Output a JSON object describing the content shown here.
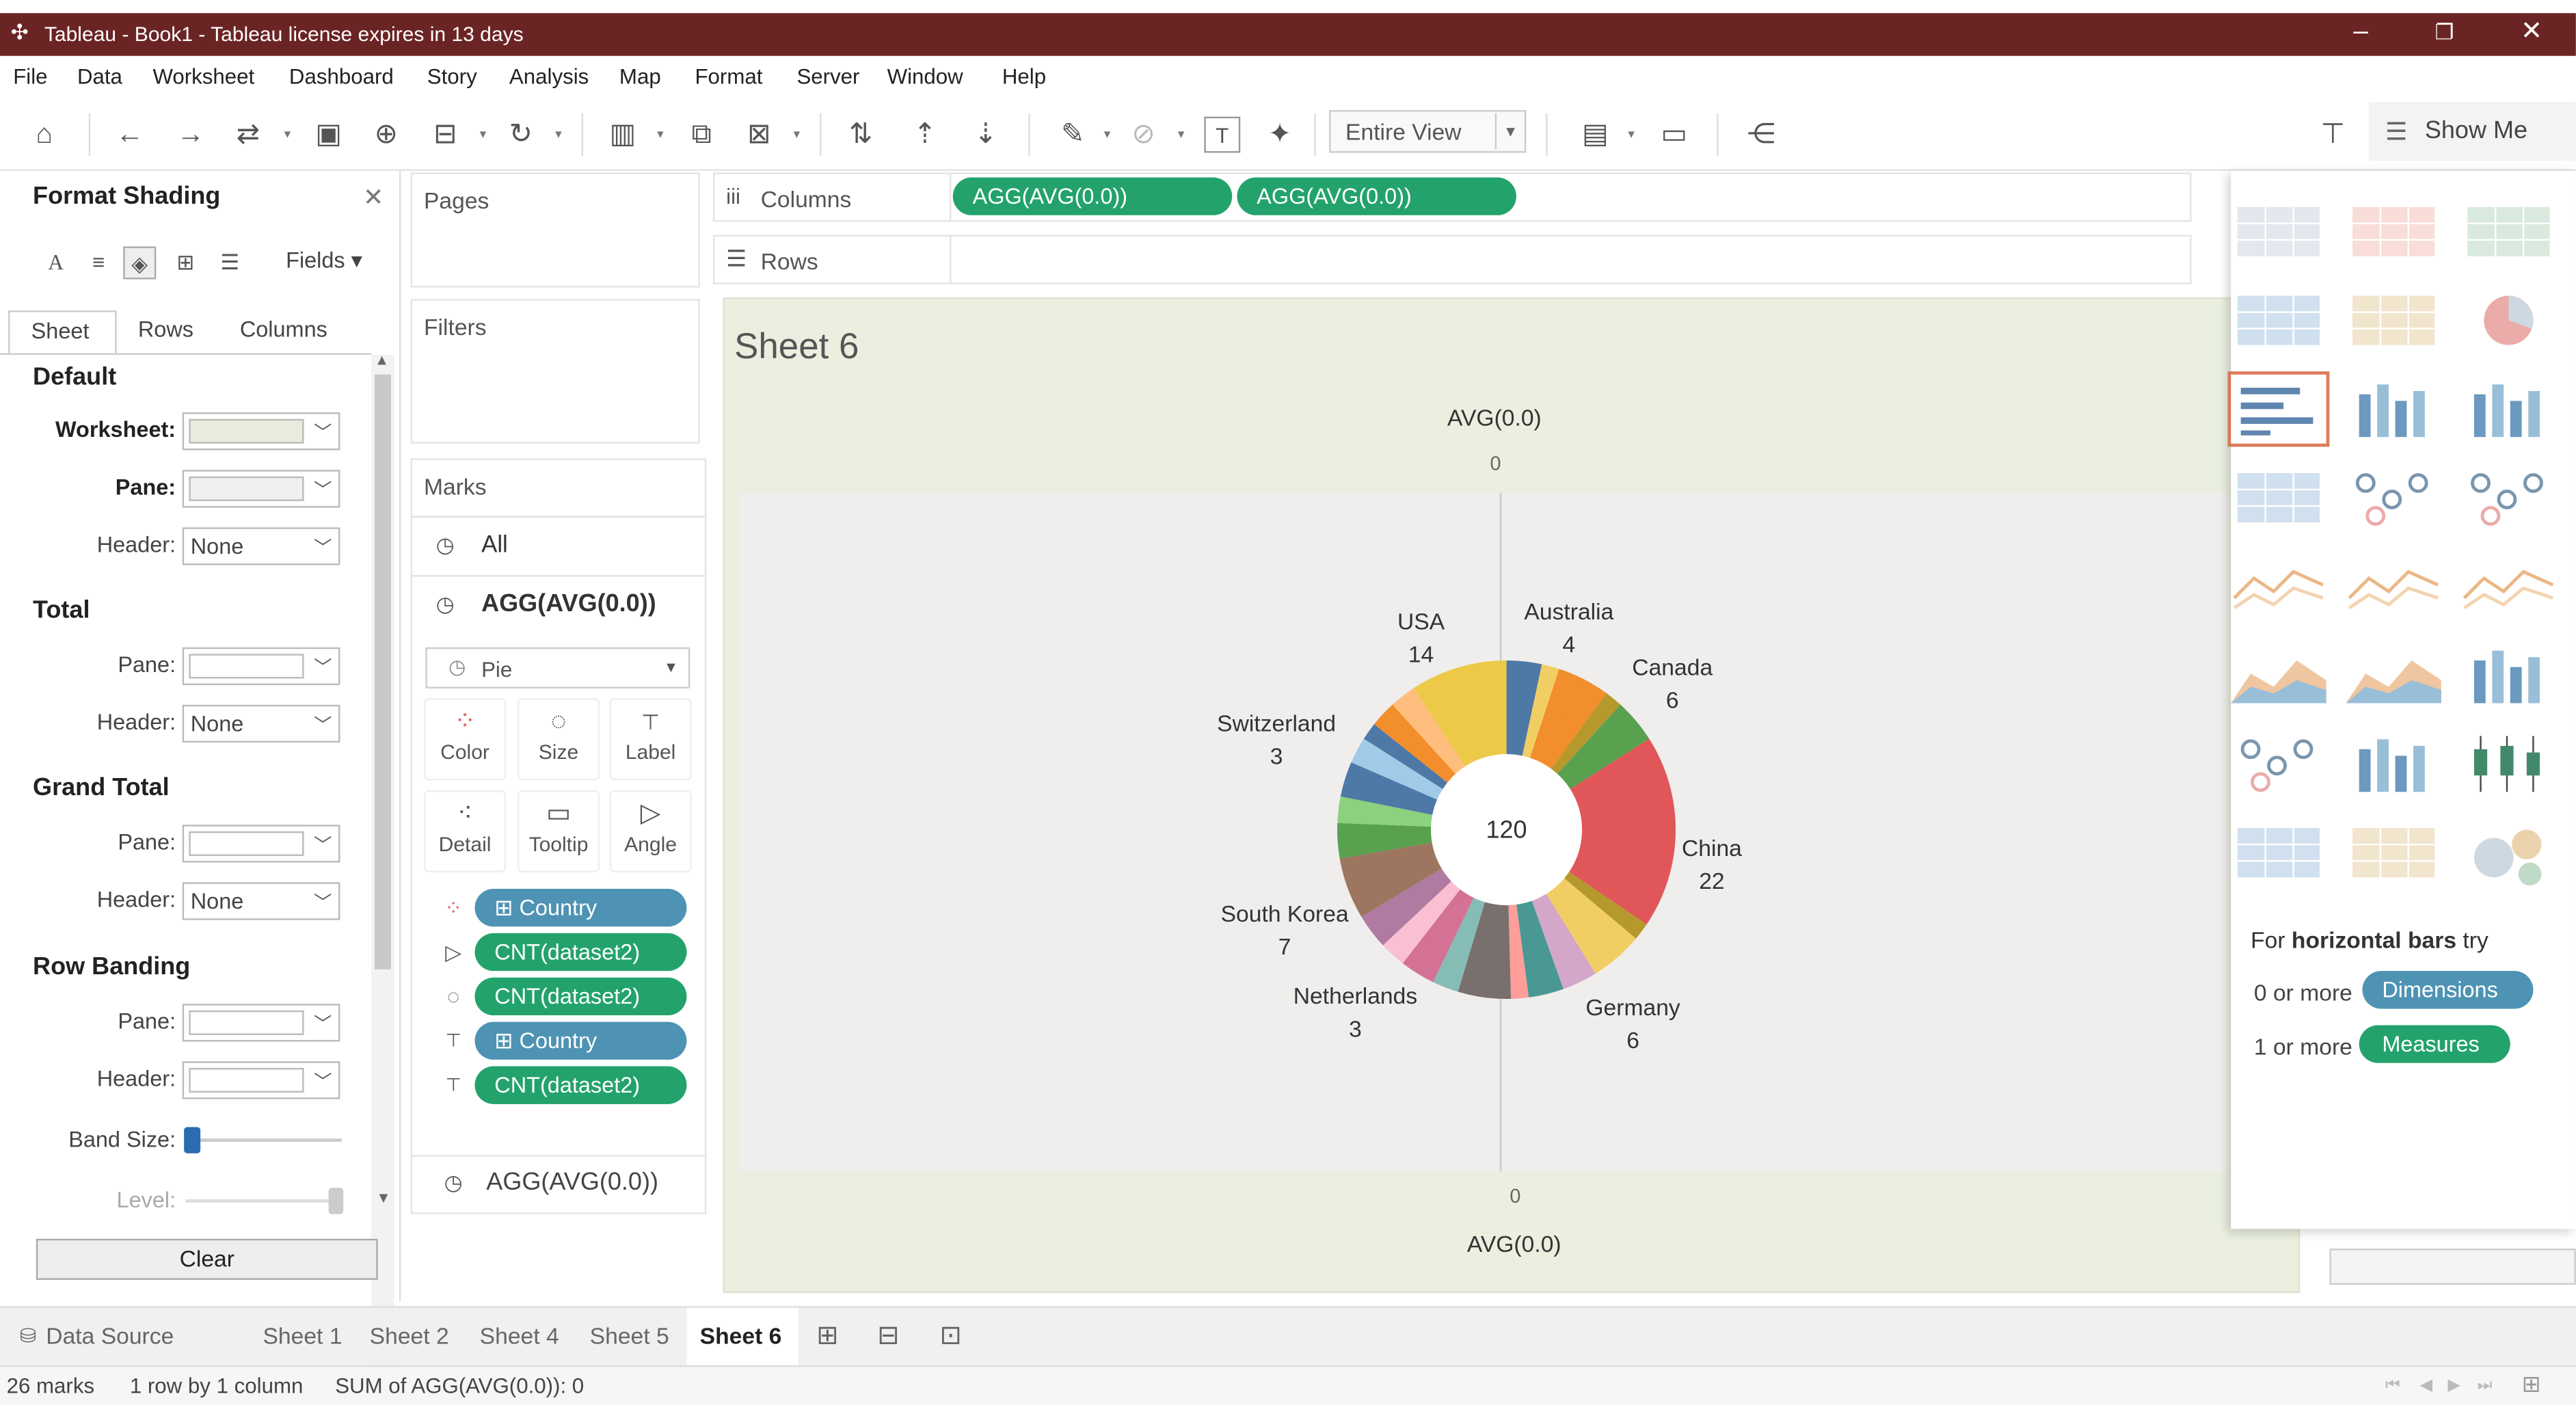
{
  "window": {
    "title": "Tableau - Book1 - Tableau license expires in 13 days",
    "minimize": "‒",
    "restore": "❐",
    "close": "✕"
  },
  "menu": [
    "File",
    "Data",
    "Worksheet",
    "Dashboard",
    "Story",
    "Analysis",
    "Map",
    "Format",
    "Server",
    "Window",
    "Help"
  ],
  "toolbar": {
    "fit_value": "Entire View",
    "show_me_label": "Show Me"
  },
  "format_panel": {
    "title": "Format Shading",
    "fields_label": "Fields",
    "tabs": [
      "Sheet",
      "Rows",
      "Columns"
    ],
    "sections": {
      "default": {
        "title": "Default",
        "worksheet_label": "Worksheet:",
        "pane_label": "Pane:",
        "header_label": "Header:",
        "header_value": "None",
        "worksheet_color": "#e8ecdc",
        "pane_color": "#f0efed"
      },
      "total": {
        "title": "Total",
        "pane_label": "Pane:",
        "header_label": "Header:",
        "header_value": "None"
      },
      "grand_total": {
        "title": "Grand Total",
        "pane_label": "Pane:",
        "header_label": "Header:",
        "header_value": "None"
      },
      "row_banding": {
        "title": "Row Banding",
        "pane_label": "Pane:",
        "header_label": "Header:",
        "band_size_label": "Band Size:",
        "level_label": "Level:"
      }
    },
    "clear_label": "Clear"
  },
  "shelves": {
    "pages": "Pages",
    "filters": "Filters",
    "columns_label": "Columns",
    "rows_label": "Rows",
    "column_pills": [
      "AGG(AVG(0.0))",
      "AGG(AVG(0.0))"
    ]
  },
  "marks": {
    "title": "Marks",
    "all": "All",
    "agg": "AGG(AVG(0.0))",
    "mark_type": "Pie",
    "buttons": [
      "Color",
      "Size",
      "Label",
      "Detail",
      "Tooltip",
      "Angle"
    ],
    "fields": [
      "Country",
      "CNT(dataset2)",
      "CNT(dataset2)",
      "Country",
      "CNT(dataset2)"
    ],
    "bottom_agg": "AGG(AVG(0.0))"
  },
  "view": {
    "sheet_title": "Sheet 6",
    "top_axis_title": "AVG(0.0)",
    "top_axis_tick": "0",
    "bottom_axis_tick": "0",
    "bottom_axis_title": "AVG(0.0)",
    "center_label": "120"
  },
  "chart_data": {
    "type": "pie",
    "title": "Sheet 6",
    "total": 120,
    "labeled_slices": [
      {
        "label": "Australia",
        "value": 4
      },
      {
        "label": "Canada",
        "value": 6
      },
      {
        "label": "China",
        "value": 22
      },
      {
        "label": "Germany",
        "value": 6
      },
      {
        "label": "Netherlands",
        "value": 3
      },
      {
        "label": "South Korea",
        "value": 7
      },
      {
        "label": "Switzerland",
        "value": 3
      },
      {
        "label": "USA",
        "value": 14
      }
    ],
    "slices": [
      {
        "v": 4,
        "c": "#4e79a7"
      },
      {
        "v": 2,
        "c": "#f1ce63"
      },
      {
        "v": 2,
        "c": "#f28e2b"
      },
      {
        "v": 4,
        "c": "#f28e2b"
      },
      {
        "v": 2,
        "c": "#b6992d"
      },
      {
        "v": 5,
        "c": "#59a14f"
      },
      {
        "v": 22,
        "c": "#e15759"
      },
      {
        "v": 2,
        "c": "#b6992d"
      },
      {
        "v": 6,
        "c": "#f1ce63"
      },
      {
        "v": 4,
        "c": "#d4a6c8"
      },
      {
        "v": 4,
        "c": "#499894"
      },
      {
        "v": 2,
        "c": "#ff9d9a"
      },
      {
        "v": 6,
        "c": "#79706e"
      },
      {
        "v": 3,
        "c": "#86bcb6"
      },
      {
        "v": 4,
        "c": "#d37295"
      },
      {
        "v": 3,
        "c": "#fabfd2"
      },
      {
        "v": 4,
        "c": "#b07aa1"
      },
      {
        "v": 7,
        "c": "#9d7660"
      },
      {
        "v": 4,
        "c": "#59a14f"
      },
      {
        "v": 3,
        "c": "#8cd17d"
      },
      {
        "v": 4,
        "c": "#4e79a7"
      },
      {
        "v": 3,
        "c": "#a0cbe8"
      },
      {
        "v": 2,
        "c": "#4e79a7"
      },
      {
        "v": 3,
        "c": "#f28e2b"
      },
      {
        "v": 3,
        "c": "#ffbe7d"
      },
      {
        "v": 11,
        "c": "#edc948"
      }
    ]
  },
  "show_me": {
    "hint_prefix": "For ",
    "hint_bold": "horizontal bars",
    "hint_suffix": " try",
    "dims_prefix": "0 or more",
    "dims_label": "Dimensions",
    "meas_prefix": "1 or more",
    "meas_label": "Measures"
  },
  "tabs": [
    "Data Source",
    "Sheet 1",
    "Sheet 2",
    "Sheet 4",
    "Sheet 5",
    "Sheet 6"
  ],
  "status": {
    "marks": "26 marks",
    "dims": "1 row by 1 column",
    "sum": "SUM of AGG(AVG(0.0)): 0"
  }
}
